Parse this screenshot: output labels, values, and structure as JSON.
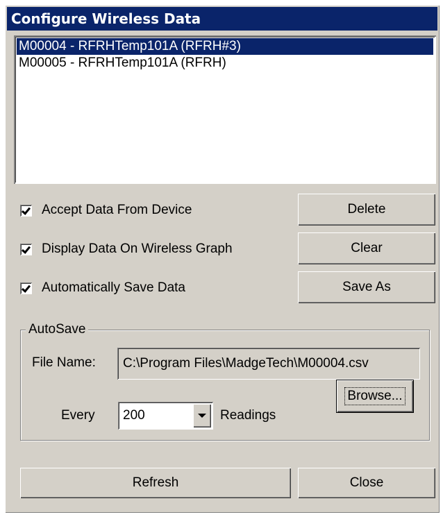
{
  "window": {
    "title": "Configure Wireless Data"
  },
  "device_list": {
    "items": [
      {
        "label": "M00004 - RFRHTemp101A (RFRH#3)",
        "selected": true
      },
      {
        "label": "M00005 - RFRHTemp101A (RFRH)",
        "selected": false
      }
    ]
  },
  "options": {
    "accept_data": {
      "label": "Accept Data From Device",
      "checked": true
    },
    "display_graph": {
      "label": "Display Data On Wireless Graph",
      "checked": true
    },
    "auto_save": {
      "label": "Automatically Save Data",
      "checked": true
    }
  },
  "buttons": {
    "delete": "Delete",
    "clear": "Clear",
    "save_as": "Save As",
    "browse": "Browse...",
    "refresh": "Refresh",
    "close": "Close"
  },
  "autosave": {
    "group_label": "AutoSave",
    "file_name_label": "File Name:",
    "file_name_value": "C:\\Program Files\\MadgeTech\\M00004.csv",
    "every_label": "Every",
    "interval_value": "200",
    "readings_label": "Readings"
  },
  "colors": {
    "face": "#d4d0c8",
    "selection": "#0a246a",
    "title_bar": "#0a246a"
  }
}
